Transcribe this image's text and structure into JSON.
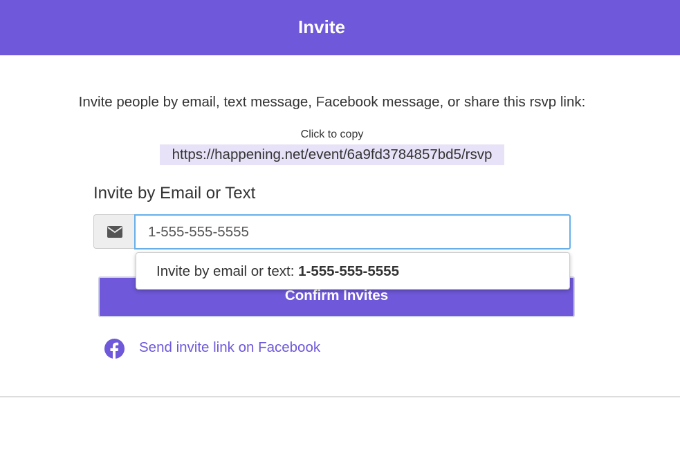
{
  "header": {
    "title": "Invite"
  },
  "intro": {
    "text": "Invite people by email, text message, Facebook message, or share this rsvp link:"
  },
  "rsvp": {
    "hint": "Click to copy",
    "link": "https://happening.net/event/6a9fd3784857bd5/rsvp"
  },
  "invite_form": {
    "title": "Invite by Email or Text",
    "input_icon": "envelope-icon",
    "input_value": "1-555-555-5555",
    "suggestion_prefix": "Invite by email or text: ",
    "suggestion_value": "1-555-555-5555",
    "confirm_label": "Confirm Invites"
  },
  "facebook": {
    "icon": "facebook-icon",
    "label": "Send invite link on Facebook"
  },
  "colors": {
    "accent": "#6f58d9",
    "link_background": "#e7e2f7",
    "input_focus_border": "#66afe9"
  }
}
